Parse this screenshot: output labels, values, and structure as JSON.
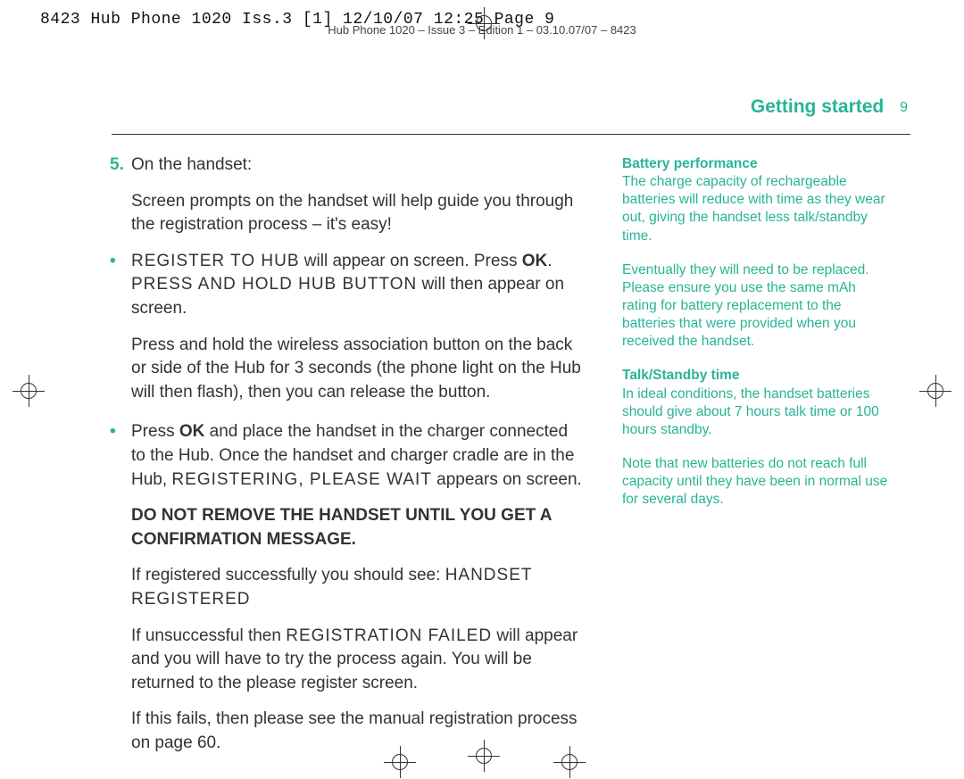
{
  "slug": "8423 Hub Phone 1020 Iss.3 [1]  12/10/07  12:25  Page 9",
  "secondary_slug": "Hub Phone 1020 – Issue 3 – Edition 1 – 03.10.07/07 – 8423",
  "heading": "Getting started",
  "page_number": "9",
  "main": {
    "step_num": "5.",
    "step_intro": "On the handset:",
    "intro2": "Screen prompts on the handset will help guide you through the registration process – it's easy!",
    "b1_lcd1": "REGISTER TO HUB",
    "b1_text1": " will appear on screen. Press ",
    "b1_ok": "OK",
    "b1_text2": ". ",
    "b1_lcd2": "PRESS AND HOLD HUB BUTTON",
    "b1_text3": " will then appear on screen.",
    "b1_p2": "Press and hold the wireless association button on the back or side of the Hub for 3 seconds (the phone light on the Hub will then flash), then you can release the button.",
    "b2_text1": "Press ",
    "b2_ok": "OK",
    "b2_text2": " and place the handset in the charger connected to the Hub. Once the handset and charger cradle are in the Hub, ",
    "b2_lcd": "REGISTERING, PLEASE WAIT",
    "b2_text3": " appears on screen.",
    "warn": "DO NOT REMOVE THE HANDSET UNTIL YOU GET A CONFIRMATION MESSAGE.",
    "succ_text1": "If registered successfully you should see: ",
    "succ_lcd": "HANDSET REGISTERED",
    "fail_text1": "If unsuccessful then ",
    "fail_lcd": "REGISTRATION FAILED",
    "fail_text2": " will appear and you will have to try the process again. You will be returned to the please register screen.",
    "final": "If this fails, then please see the manual registration process on page 60."
  },
  "sidebar": {
    "h1": "Battery performance",
    "p1": "The charge capacity of rechargeable batteries will reduce with time as they wear out, giving the handset less talk/standby time.",
    "p2": "Eventually they will need to be replaced. Please ensure you use the same mAh rating for battery replacement to the batteries that were provided when you received the handset.",
    "h2": "Talk/Standby time",
    "p3": "In ideal conditions, the handset batteries should give about 7 hours talk time or 100 hours standby.",
    "p4": "Note that new batteries do not reach full capacity until they have been in normal use for several days."
  }
}
